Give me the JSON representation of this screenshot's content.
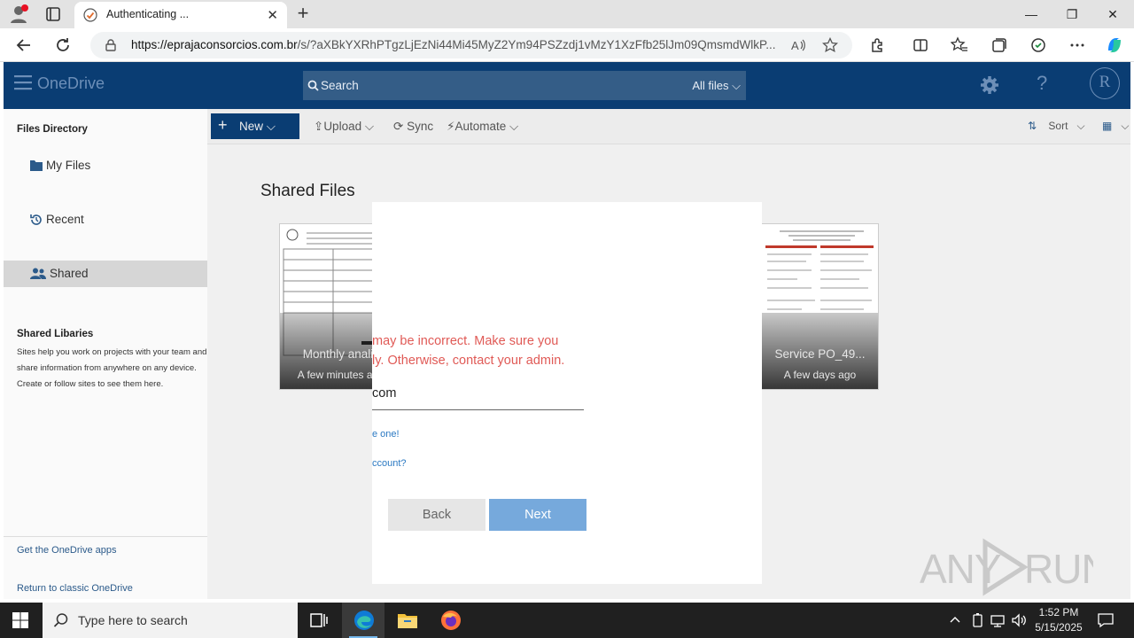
{
  "browser": {
    "tab_title": "Authenticating ...",
    "url_host": "https://eprajaconsorcios.com.br",
    "url_path": "/s/?aXBkYXRhPTgzLjEzNi44Mi45MyZ2Ym94PSZzdj1vMzY1XzFfb25lJm09QmsmdWlkP..."
  },
  "onedrive": {
    "app_title": "OneDrive",
    "search_placeholder": "Search",
    "search_filter": "All files",
    "avatar_initial": "R",
    "sidebar": {
      "heading": "Files Directory",
      "items": [
        {
          "label": "My Files"
        },
        {
          "label": "Recent"
        },
        {
          "label": "Shared"
        }
      ],
      "libraries_heading": "Shared Libaries",
      "libraries_text": "Sites help you work on projects with your team and share information from anywhere on any device. Create or follow sites to see them here.",
      "get_apps": "Get the OneDrive apps",
      "return_classic": "Return to classic OneDrive"
    },
    "commands": {
      "new": "New",
      "upload": "Upload",
      "sync": "Sync",
      "automate": "Automate",
      "sort": "Sort"
    },
    "section_title": "Shared Files",
    "tiles": [
      {
        "name": "Monthly anali",
        "date": "A few minutes ag"
      },
      {
        "name": "Service PO_49...",
        "date": "A few days ago"
      }
    ]
  },
  "modal": {
    "error_line1": "may be incorrect. Make sure you",
    "error_line2": "ly. Otherwise, contact your admin.",
    "input_value": "com",
    "link1": "e one!",
    "link2": "ccount?",
    "back": "Back",
    "next": "Next"
  },
  "watermark": "ANY RUN",
  "taskbar": {
    "search_placeholder": "Type here to search",
    "time": "1:52 PM",
    "date": "5/15/2025"
  },
  "colors": {
    "onedrive_header": "#0a3d73",
    "error": "#e05a56",
    "next_button": "#76a9dc",
    "link": "#2b79c2"
  }
}
